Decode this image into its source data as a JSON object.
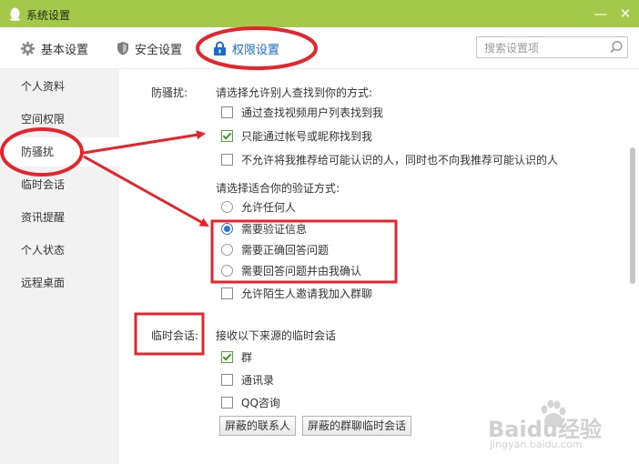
{
  "window": {
    "title": "系统设置",
    "minimize_glyph": "—",
    "close_glyph": "✕"
  },
  "tabs": [
    {
      "label": "基本设置",
      "icon": "gear-icon"
    },
    {
      "label": "安全设置",
      "icon": "shield-icon"
    },
    {
      "label": "权限设置",
      "icon": "lock-icon",
      "active": true
    }
  ],
  "search": {
    "placeholder": "搜索设置项"
  },
  "sidebar": {
    "items": [
      {
        "label": "个人资料"
      },
      {
        "label": "空间权限"
      },
      {
        "label": "防骚扰",
        "active": true
      },
      {
        "label": "临时会话"
      },
      {
        "label": "资讯提醒"
      },
      {
        "label": "个人状态"
      },
      {
        "label": "远程桌面"
      }
    ]
  },
  "harassment": {
    "section_label": "防骚扰:",
    "find_prompt": "请选择允许别人查找到你的方式:",
    "find_options": [
      {
        "label": "通过查找视频用户列表找到我",
        "checked": false
      },
      {
        "label": "只能通过帐号或昵称找到我",
        "checked": true
      },
      {
        "label": "不允许将我推荐给可能认识的人，同时也不向我推荐可能认识的人",
        "checked": false
      }
    ],
    "verify_prompt": "请选择适合你的验证方式:",
    "verify_options": [
      {
        "label": "允许任何人",
        "selected": false
      },
      {
        "label": "需要验证信息",
        "selected": true
      },
      {
        "label": "需要正确回答问题",
        "selected": false
      },
      {
        "label": "需要回答问题并由我确认",
        "selected": false
      }
    ],
    "group_invite": {
      "label": "允许陌生人邀请我加入群聊",
      "checked": false
    }
  },
  "temp_session": {
    "section_label": "临时会话:",
    "prompt": "接收以下来源的临时会话",
    "options": [
      {
        "label": "群",
        "checked": true
      },
      {
        "label": "通讯录",
        "checked": false
      },
      {
        "label": "QQ咨询",
        "checked": false
      }
    ],
    "blocked_contacts_button": "屏蔽的联系人",
    "blocked_group_sessions_button": "屏蔽的群聊临时会话"
  },
  "watermark": {
    "brand": "Baidu经验",
    "url": "jingyan.baidu.com"
  },
  "colors": {
    "titlebar": "#a3c84a",
    "accent": "#1a6bd0",
    "annotation_red": "#e8232a",
    "check_green": "#3b9a2a"
  }
}
